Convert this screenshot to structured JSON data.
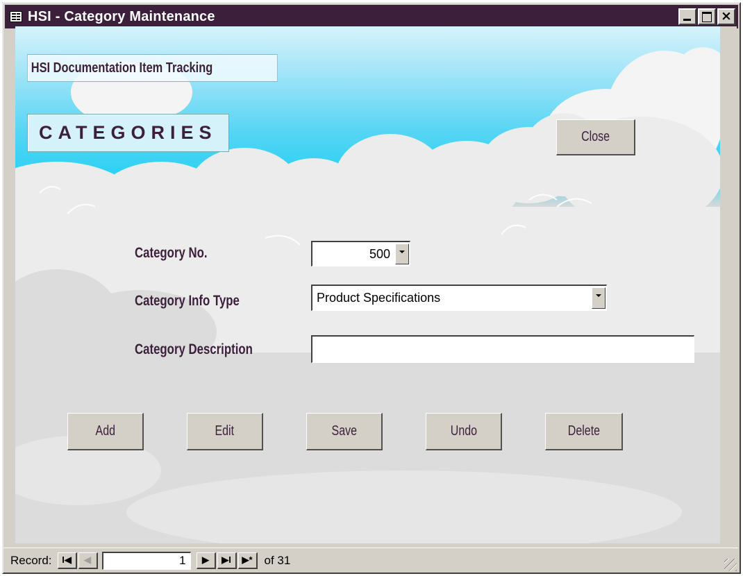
{
  "window": {
    "title": "HSI - Category Maintenance",
    "minimize_icon": "minimize-icon",
    "maximize_icon": "maximize-icon",
    "close_glyph": "×"
  },
  "form": {
    "app_title": "HSI Documentation Item Tracking",
    "heading": "CATEGORIES",
    "close_button": "Close",
    "fields": {
      "category_no": {
        "label": "Category No.",
        "value": "500"
      },
      "category_info_type": {
        "label": "Category Info Type",
        "value": "Product Specifications"
      },
      "category_description": {
        "label": "Category Description",
        "value": ""
      }
    },
    "actions": {
      "add": "Add",
      "edit": "Edit",
      "save": "Save",
      "undo": "Undo",
      "delete": "Delete"
    }
  },
  "record_nav": {
    "label": "Record:",
    "first_glyph": "I◀",
    "prev_glyph": "◀",
    "current": "1",
    "next_glyph": "▶",
    "last_glyph": "▶I",
    "new_glyph": "▶*",
    "of_text": "of 31"
  },
  "colors": {
    "titlebar": "#3b1f3b",
    "label_text": "#3b1f3b",
    "sky": "#2fd1f4",
    "cloud": "#d9d9d9"
  }
}
